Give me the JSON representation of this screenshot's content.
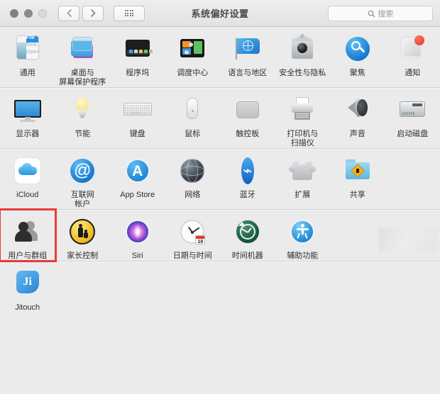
{
  "window": {
    "title": "系统偏好设置",
    "traffic_lights": [
      "close",
      "minimize",
      "zoom"
    ],
    "nav": {
      "back": "‹",
      "forward": "›",
      "grid": "grid-view"
    },
    "search": {
      "placeholder": "搜索",
      "value": "",
      "icon": "search-icon"
    }
  },
  "rows": [
    {
      "id": "row-personal",
      "items": [
        {
          "label": "通用",
          "icon": "general-icon"
        },
        {
          "label": "桌面与\n屏幕保护程序",
          "icon": "desktop-screensaver-icon"
        },
        {
          "label": "程序坞",
          "icon": "dock-icon"
        },
        {
          "label": "调度中心",
          "icon": "mission-control-icon"
        },
        {
          "label": "语言与地区",
          "icon": "language-region-icon"
        },
        {
          "label": "安全性与隐私",
          "icon": "security-privacy-icon"
        },
        {
          "label": "聚焦",
          "icon": "spotlight-icon"
        },
        {
          "label": "通知",
          "icon": "notifications-icon",
          "badge": true
        }
      ]
    },
    {
      "id": "row-hardware",
      "items": [
        {
          "label": "显示器",
          "icon": "displays-icon"
        },
        {
          "label": "节能",
          "icon": "energy-saver-icon"
        },
        {
          "label": "键盘",
          "icon": "keyboard-icon"
        },
        {
          "label": "鼠标",
          "icon": "mouse-icon"
        },
        {
          "label": "触控板",
          "icon": "trackpad-icon"
        },
        {
          "label": "打印机与\n扫描仪",
          "icon": "printers-scanners-icon"
        },
        {
          "label": "声音",
          "icon": "sound-icon"
        },
        {
          "label": "启动磁盘",
          "icon": "startup-disk-icon"
        }
      ]
    },
    {
      "id": "row-internet",
      "items": [
        {
          "label": "iCloud",
          "icon": "icloud-icon"
        },
        {
          "label": "互联网\n帐户",
          "icon": "internet-accounts-icon"
        },
        {
          "label": "App Store",
          "icon": "app-store-icon"
        },
        {
          "label": "网络",
          "icon": "network-icon"
        },
        {
          "label": "蓝牙",
          "icon": "bluetooth-icon"
        },
        {
          "label": "扩展",
          "icon": "extensions-icon"
        },
        {
          "label": "共享",
          "icon": "sharing-icon"
        }
      ]
    },
    {
      "id": "row-system",
      "items": [
        {
          "label": "用户与群组",
          "icon": "users-groups-icon",
          "selected": true
        },
        {
          "label": "家长控制",
          "icon": "parental-controls-icon"
        },
        {
          "label": "Siri",
          "icon": "siri-icon"
        },
        {
          "label": "日期与时间",
          "icon": "date-time-icon",
          "calendar_day": "18"
        },
        {
          "label": "时间机器",
          "icon": "time-machine-icon"
        },
        {
          "label": "辅助功能",
          "icon": "accessibility-icon"
        }
      ]
    },
    {
      "id": "row-other",
      "items": [
        {
          "label": "Jitouch",
          "icon": "jitouch-icon",
          "badge_text": "Ji"
        }
      ]
    }
  ],
  "highlight": {
    "color": "#e83b3b",
    "target": "用户与群组"
  }
}
